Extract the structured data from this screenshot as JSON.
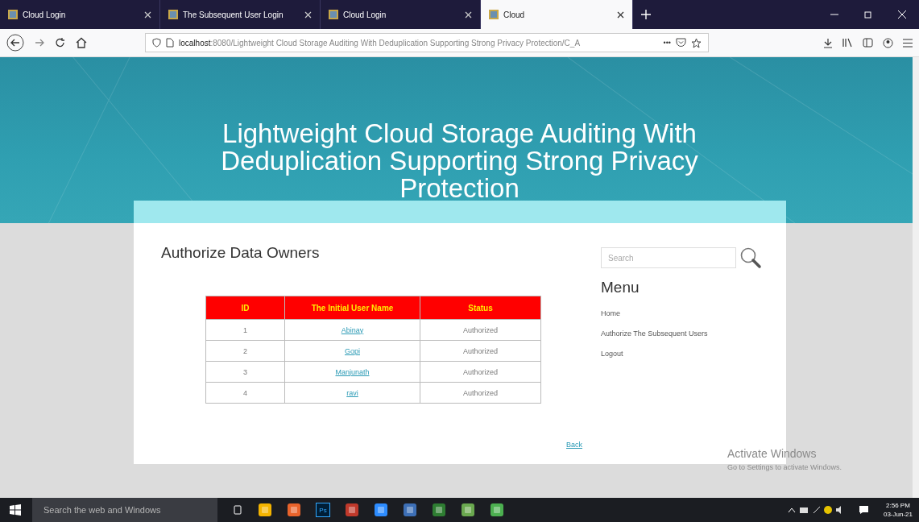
{
  "browser": {
    "tabs": [
      {
        "title": "Cloud Login",
        "selected": false
      },
      {
        "title": "The Subsequent User Login",
        "selected": false
      },
      {
        "title": "Cloud Login",
        "selected": false
      },
      {
        "title": "Cloud",
        "selected": true
      }
    ],
    "url_host": "localhost",
    "url_rest": ":8080/Lightweight Cloud Storage Auditing With Deduplication Supporting Strong Privacy Protection/C_A",
    "url_more": "•••"
  },
  "page": {
    "banner_title": "Lightweight Cloud Storage Auditing With Deduplication Supporting Strong Privacy Protection",
    "heading": "Authorize Data Owners",
    "table": {
      "columns": [
        "ID",
        "The Initial User Name",
        "Status"
      ],
      "rows": [
        {
          "id": "1",
          "name": "Abinay",
          "status": "Authorized"
        },
        {
          "id": "2",
          "name": "Gopi",
          "status": "Authorized"
        },
        {
          "id": "3",
          "name": "Manjunath",
          "status": "Authorized"
        },
        {
          "id": "4",
          "name": "ravi",
          "status": "Authorized"
        }
      ]
    },
    "back_link": "Back",
    "search": {
      "placeholder": "Search"
    },
    "menu_title": "Menu",
    "menu": [
      "Home",
      "Authorize The Subsequent Users",
      "Logout"
    ]
  },
  "activation": {
    "title": "Activate Windows",
    "subtitle": "Go to Settings to activate Windows."
  },
  "taskbar": {
    "search_placeholder": "Search the web and Windows",
    "ps_label": "Ps",
    "time": "2:56 PM",
    "date": "03-Jun-21"
  }
}
